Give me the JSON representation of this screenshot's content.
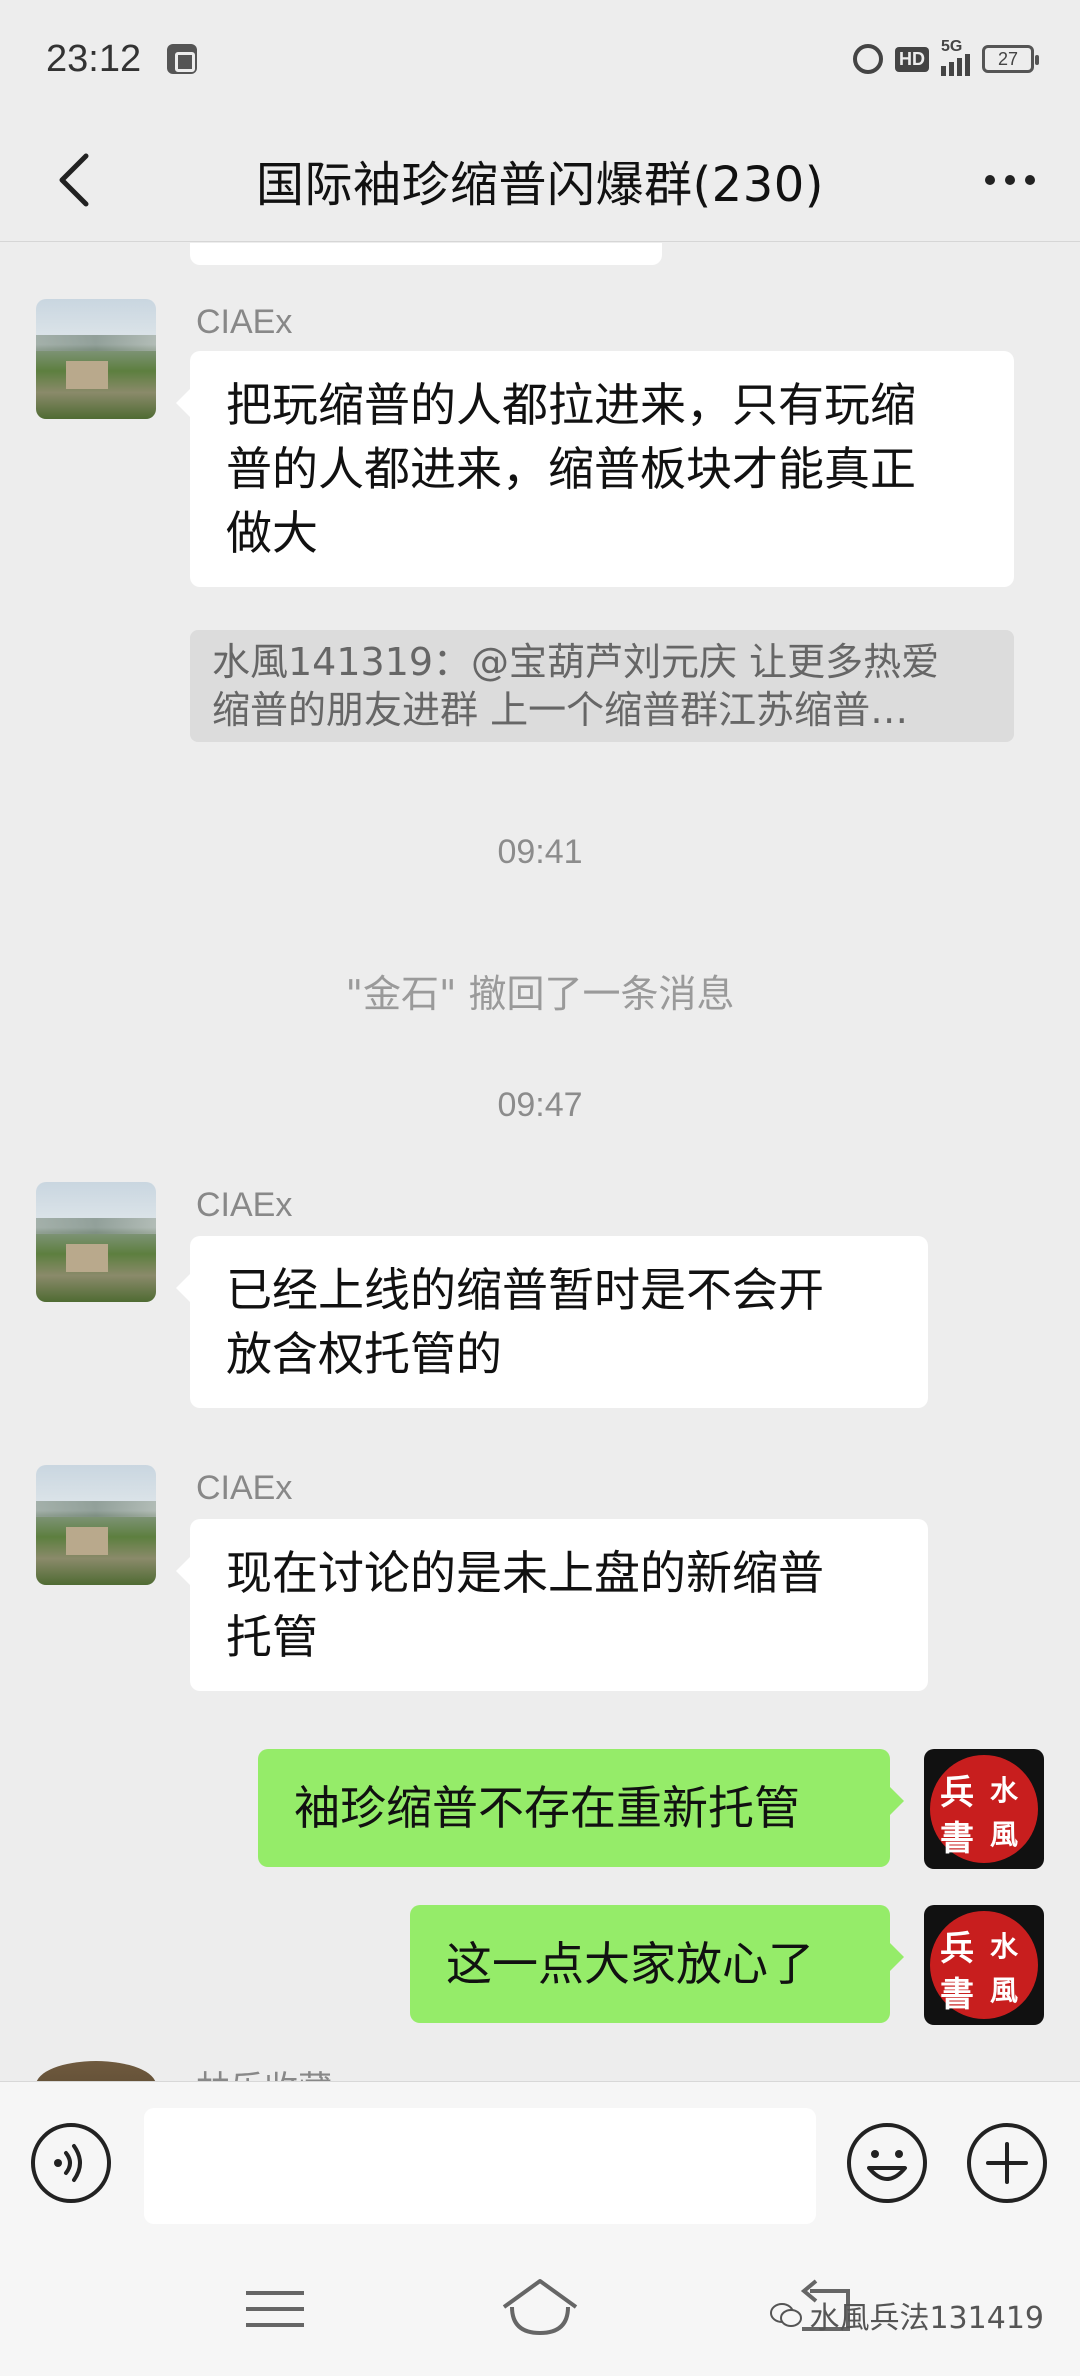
{
  "status_bar": {
    "time": "23:12",
    "network": "5G",
    "hd": "HD",
    "battery": "27"
  },
  "nav": {
    "title": "国际袖珍缩普闪爆群(230)"
  },
  "messages": [
    {
      "sender": "CIAEx",
      "lines": [
        "把玩缩普的人都拉进来，只有玩缩",
        "普的人都进来，缩普板块才能真正",
        "做大"
      ],
      "quote": [
        "水風141319：@宝葫芦刘元庆 让更多热爱",
        "缩普的朋友进群 上一个缩普群江苏缩普…"
      ]
    },
    {
      "time": "09:41"
    },
    {
      "system": "\"金石\" 撤回了一条消息"
    },
    {
      "time": "09:47"
    },
    {
      "sender": "CIAEx",
      "lines": [
        "已经上线的缩普暂时是不会开",
        "放含权托管的"
      ]
    },
    {
      "sender": "CIAEx",
      "lines": [
        "现在讨论的是未上盘的新缩普",
        "托管"
      ]
    },
    {
      "self": "袖珍缩普不存在重新托管"
    },
    {
      "self": "这一点大家放心了"
    },
    {
      "sender_partial": "林乐收藏"
    }
  ],
  "self_avatar": {
    "chars": [
      "兵",
      "書",
      "水",
      "風"
    ]
  },
  "input": {
    "value": ""
  },
  "watermark": {
    "text": "水風兵法131419"
  },
  "colors": {
    "self_bubble": "#95ec69",
    "background": "#ededed",
    "seal": "#c81e1e"
  }
}
